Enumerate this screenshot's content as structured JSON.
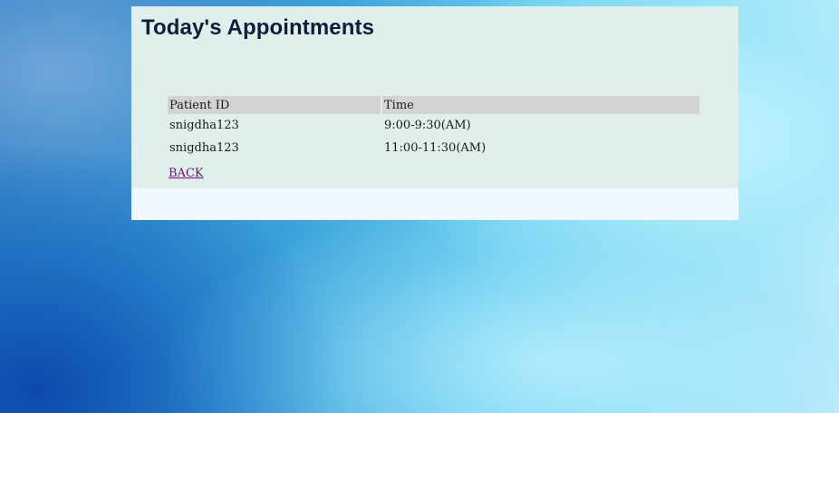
{
  "page": {
    "title": "Today's Appointments"
  },
  "table": {
    "headers": {
      "patient_id": "Patient ID",
      "time": "Time"
    },
    "rows": [
      {
        "patient_id": "snigdha123",
        "time": "9:00-9:30(AM)"
      },
      {
        "patient_id": "snigdha123",
        "time": "11:00-11:30(AM)"
      }
    ]
  },
  "links": {
    "back": "BACK"
  },
  "colors": {
    "panel": "#e0eeec",
    "panel_footer": "#f0f7fd",
    "header_cell": "#d3d3d3",
    "title_text": "#0c1f3a",
    "visited_link": "#6b0e7a"
  }
}
